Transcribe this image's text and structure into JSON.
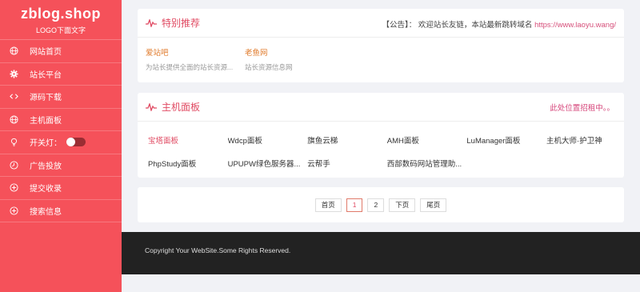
{
  "brand": {
    "title": "zblog.shop",
    "subtitle": "LOGO下面文字"
  },
  "nav": [
    {
      "label": "网站首页",
      "icon": "globe-icon"
    },
    {
      "label": "站长平台",
      "icon": "gear-icon"
    },
    {
      "label": "源码下载",
      "icon": "code-icon"
    },
    {
      "label": "主机面板",
      "icon": "globe-icon"
    },
    {
      "label": "开关灯：",
      "icon": "lightbulb-icon"
    },
    {
      "label": "广告投放",
      "icon": "clock-icon"
    },
    {
      "label": "提交收录",
      "icon": "plus-circle-icon"
    },
    {
      "label": "搜索信息",
      "icon": "plus-circle-icon"
    }
  ],
  "featured": {
    "title": "特别推荐",
    "notice_prefix": "【公告】：  欢迎站长友链，本站最新跳转域名 ",
    "notice_link": "https://www.laoyu.wang/",
    "items": [
      {
        "name": "爱站吧",
        "desc": "为站长提供全面的站长资源..."
      },
      {
        "name": "老鱼网",
        "desc": "站长资源信息网"
      }
    ]
  },
  "hosting": {
    "title": "主机面板",
    "ad_text": "此处位置招租中。。",
    "items": [
      "宝塔面板",
      "Wdcp面板",
      "旗鱼云梯",
      "AMH面板",
      "LuManager面板",
      "主机大师·护卫神",
      "PhpStudy面板",
      "UPUPW绿色服务器...",
      "云帮手",
      "西部数码网站管理助..."
    ]
  },
  "pager": {
    "first": "首页",
    "page1": "1",
    "page2": "2",
    "next": "下页",
    "last": "尾页"
  },
  "footer": {
    "copyright": "Copyright Your WebSite.Some Rights Reserved."
  },
  "colors": {
    "sidebar": "#f5515a",
    "accent": "#e04a62",
    "footer": "#222222"
  }
}
